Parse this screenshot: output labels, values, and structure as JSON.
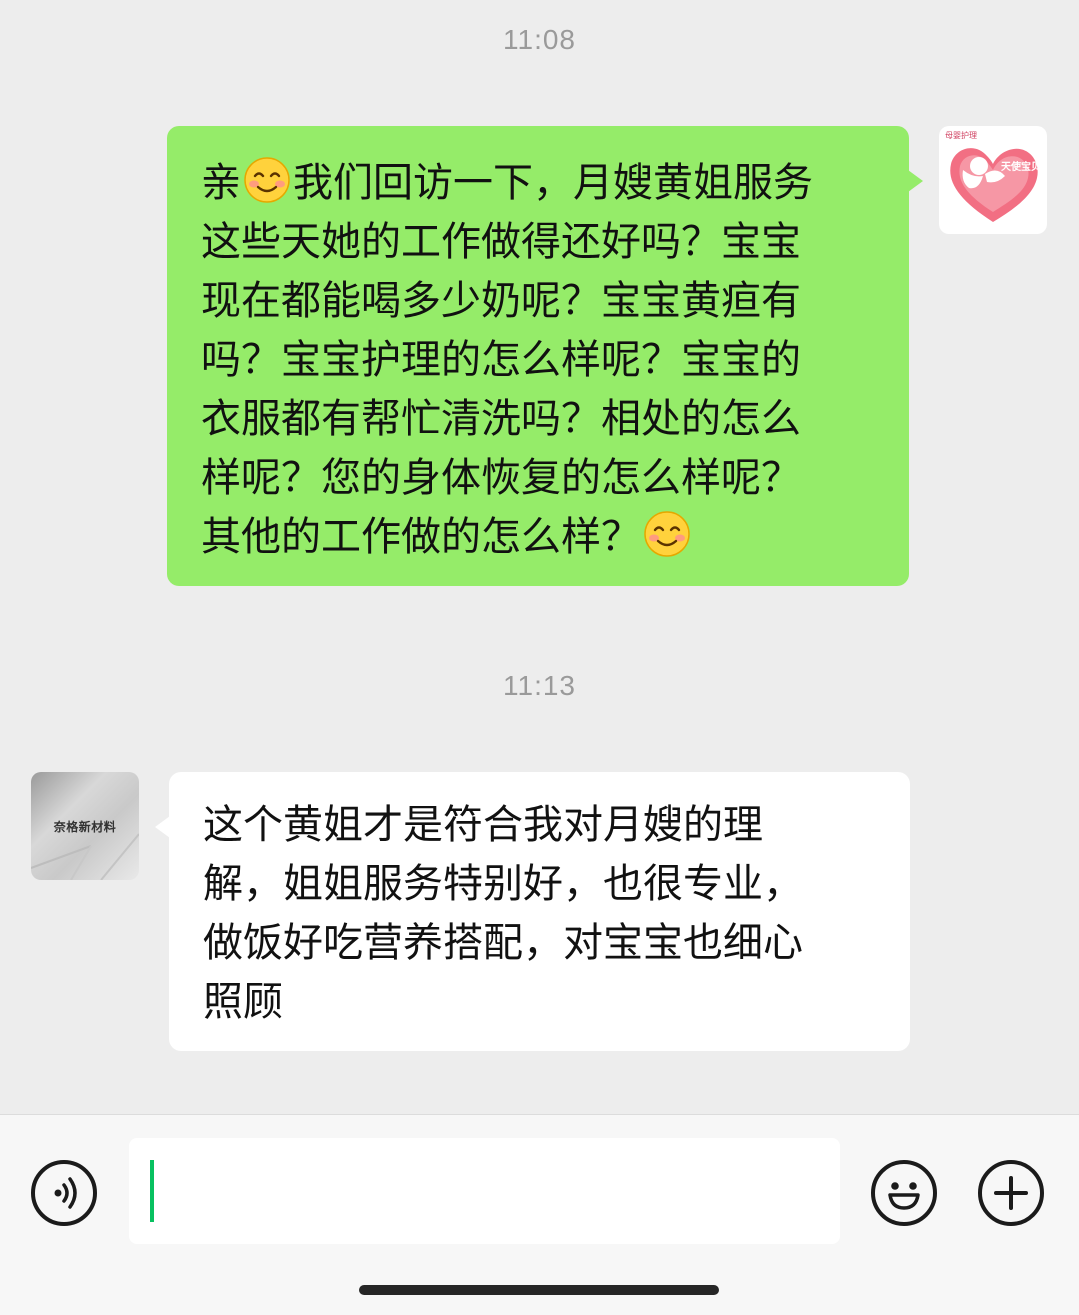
{
  "messages": [
    {
      "time": "11:08",
      "direction": "outgoing",
      "avatar": {
        "logo_small": "母婴护理",
        "logo_main": "天使宝贝"
      },
      "lines": [
        {
          "pre": "亲",
          "emoji": "smiling-face",
          "post": "我们回访一下，月嫂黄姐服务"
        },
        {
          "text": "这些天她的工作做得还好吗？宝宝"
        },
        {
          "text": "现在都能喝多少奶呢？宝宝黄疸有"
        },
        {
          "text": "吗？宝宝护理的怎么样呢？宝宝的"
        },
        {
          "text": "衣服都有帮忙清洗吗？相处的怎么"
        },
        {
          "text": "样呢？您的身体恢复的怎么样呢？"
        },
        {
          "pre": "其他的工作做的怎么样？",
          "emoji": "smiling-face"
        }
      ]
    },
    {
      "time": "11:13",
      "direction": "incoming",
      "avatar": {
        "text": "奈格新材料"
      },
      "lines": [
        {
          "text": "这个黄姐才是符合我对月嫂的理"
        },
        {
          "text": "解，姐姐服务特别好，也很专业，"
        },
        {
          "text": "做饭好吃营养搭配，对宝宝也细心"
        },
        {
          "text": "照顾"
        }
      ]
    }
  ],
  "input_bar": {
    "voice_icon": "voice-icon",
    "emoji_icon": "emoji-icon",
    "plus_icon": "plus-icon",
    "input_value": ""
  },
  "colors": {
    "outgoing_bubble": "#95ec69",
    "incoming_bubble": "#ffffff",
    "background": "#ededed",
    "caret": "#07c160"
  }
}
